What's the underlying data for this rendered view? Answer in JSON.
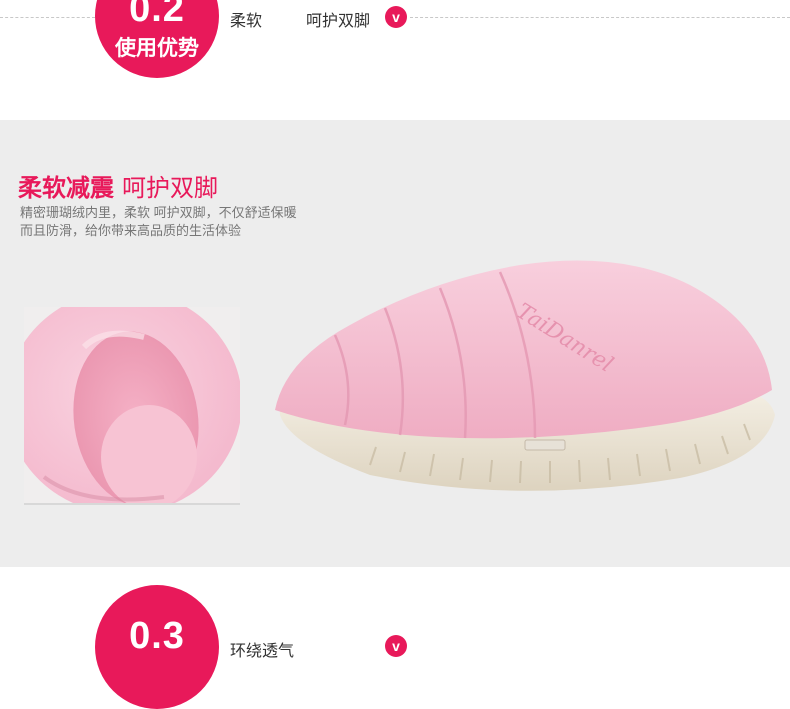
{
  "section2": {
    "number": "0.2",
    "subtitle": "使用优势",
    "text1": "柔软",
    "text2": "呵护双脚",
    "badge": "v"
  },
  "feature": {
    "title_bold": "柔软减震",
    "title_light": "呵护双脚",
    "desc_line1": "精密珊瑚绒内里，柔软    呵护双脚，不仅舒适保暖",
    "desc_line2": "而且防滑，给你带来高品质的生活体验"
  },
  "product": {
    "embroidery": "TaiDanrel",
    "color": "#f6bfd2"
  },
  "section3": {
    "number": "0.3",
    "text1": "环绕透气",
    "badge": "v"
  },
  "colors": {
    "accent": "#e8195a",
    "band": "#ededed",
    "sole": "#ece5d6"
  }
}
